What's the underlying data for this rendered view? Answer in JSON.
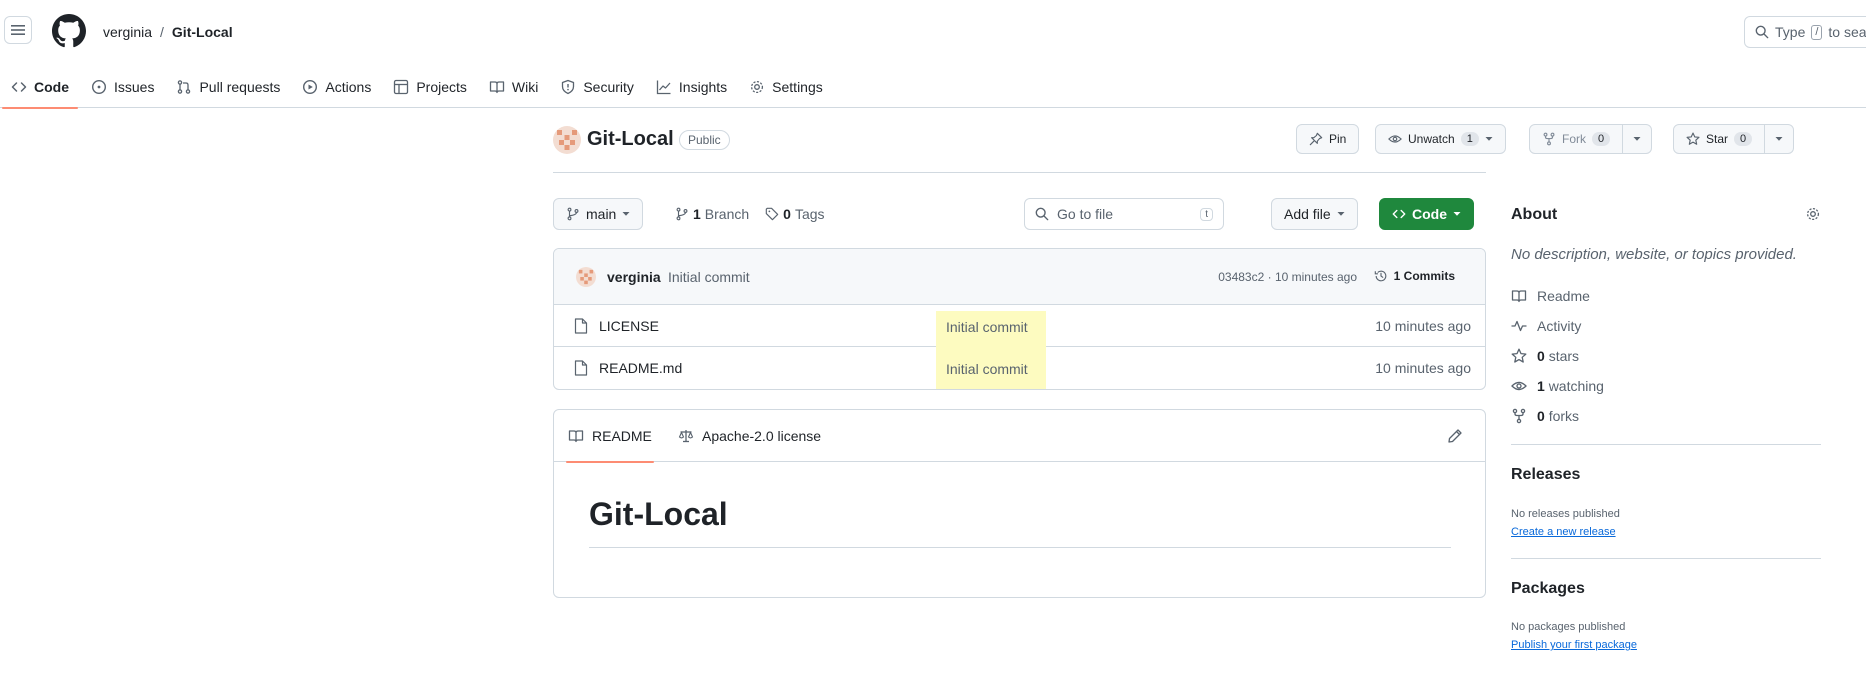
{
  "header": {
    "owner": "verginia",
    "separator": "/",
    "repo": "Git-Local",
    "search_prefix": "Type",
    "search_key": "/",
    "search_suffix": "to search"
  },
  "tabs": [
    {
      "label": "Code",
      "icon": "code-icon",
      "active": true
    },
    {
      "label": "Issues",
      "icon": "issue-icon"
    },
    {
      "label": "Pull requests",
      "icon": "pull-request-icon"
    },
    {
      "label": "Actions",
      "icon": "play-icon"
    },
    {
      "label": "Projects",
      "icon": "table-icon"
    },
    {
      "label": "Wiki",
      "icon": "book-icon"
    },
    {
      "label": "Security",
      "icon": "shield-icon"
    },
    {
      "label": "Insights",
      "icon": "graph-icon"
    },
    {
      "label": "Settings",
      "icon": "gear-icon"
    }
  ],
  "repo": {
    "name": "Git-Local",
    "visibility": "Public",
    "pin_label": "Pin",
    "unwatch_label": "Unwatch",
    "watch_count": "1",
    "fork_label": "Fork",
    "fork_count": "0",
    "star_label": "Star",
    "star_count": "0"
  },
  "branch": {
    "current": "main",
    "branch_count": "1",
    "branch_word": "Branch",
    "tag_count": "0",
    "tag_word": "Tags",
    "goto_placeholder": "Go to file",
    "goto_key": "t",
    "add_file_label": "Add file",
    "code_label": "Code"
  },
  "commit": {
    "author": "verginia",
    "message": "Initial commit",
    "sha_time": "03483c2 · 10 minutes ago",
    "commits_label": "1 Commits"
  },
  "files": [
    {
      "name": "LICENSE",
      "message": "Initial commit",
      "time": "10 minutes ago"
    },
    {
      "name": "README.md",
      "message": "Initial commit",
      "time": "10 minutes ago"
    }
  ],
  "readme": {
    "tab_readme": "README",
    "tab_license": "Apache-2.0 license",
    "heading": "Git-Local"
  },
  "sidebar": {
    "about_title": "About",
    "description": "No description, website, or topics provided.",
    "readme": "Readme",
    "activity": "Activity",
    "stars_count": "0",
    "stars_word": "stars",
    "watching_count": "1",
    "watching_word": "watching",
    "forks_count": "0",
    "forks_word": "forks",
    "releases_title": "Releases",
    "no_releases": "No releases published",
    "create_release": "Create a new release",
    "packages_title": "Packages",
    "no_packages": "No packages published",
    "publish_package": "Publish your first package"
  },
  "colors": {
    "accent_tab_underline": "#fd8c73",
    "code_button": "#1f883d",
    "highlight": "#fdfbc0",
    "link": "#0969da"
  }
}
